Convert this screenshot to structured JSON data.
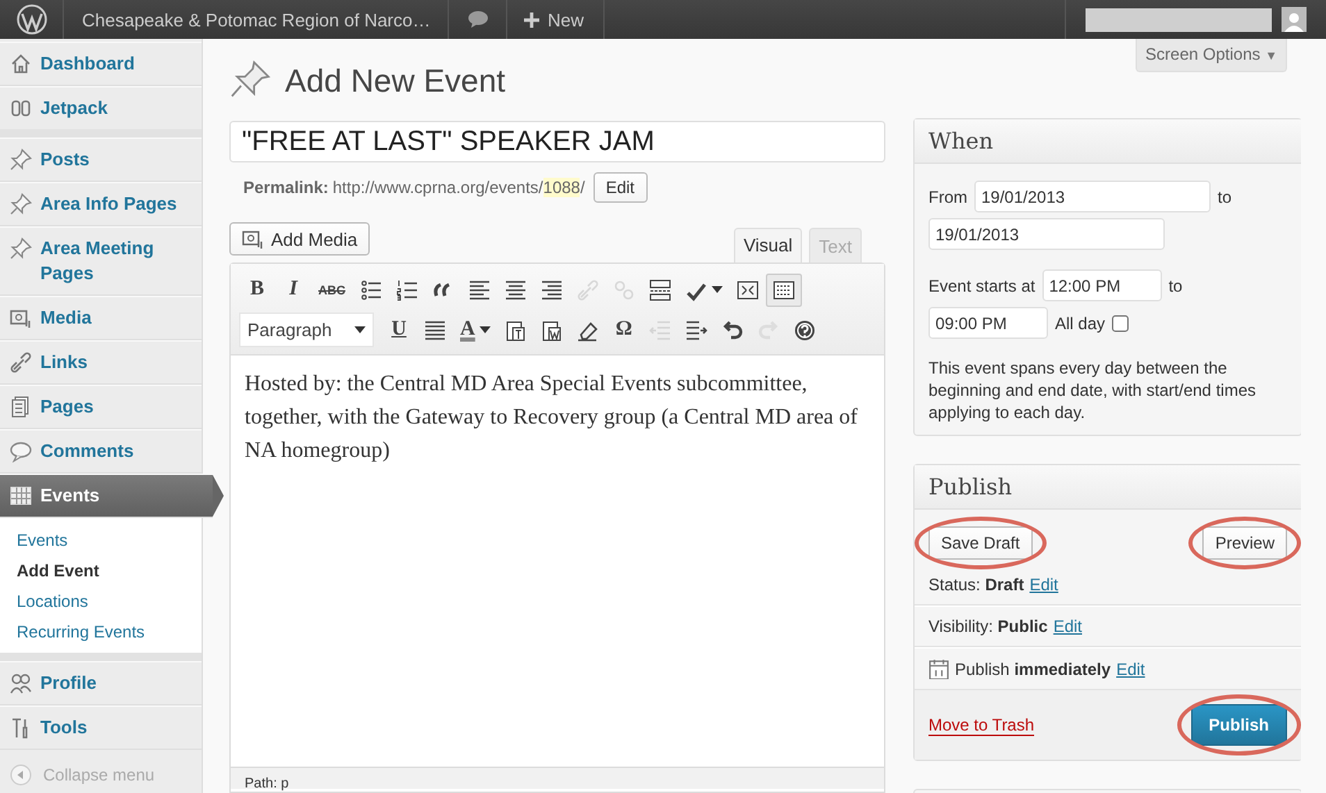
{
  "admin_bar": {
    "site_name": "Chesapeake & Potomac Region of Narco…",
    "new_label": "New"
  },
  "sidebar": {
    "items": [
      {
        "kind": "home",
        "label": "Dashboard",
        "selected": false,
        "separator_after": false
      },
      {
        "kind": "jetpack",
        "label": "Jetpack",
        "selected": false,
        "separator_after": true
      },
      {
        "kind": "pin",
        "label": "Posts",
        "selected": false,
        "separator_after": false
      },
      {
        "kind": "pin",
        "label": "Area Info Pages",
        "selected": false,
        "separator_after": false
      },
      {
        "kind": "pin",
        "label": "Area Meeting Pages",
        "selected": false,
        "separator_after": false
      },
      {
        "kind": "media",
        "label": "Media",
        "selected": false,
        "separator_after": false
      },
      {
        "kind": "link",
        "label": "Links",
        "selected": false,
        "separator_after": false
      },
      {
        "kind": "pages",
        "label": "Pages",
        "selected": false,
        "separator_after": false
      },
      {
        "kind": "comment",
        "label": "Comments",
        "selected": false,
        "separator_after": false
      },
      {
        "kind": "calendar",
        "label": "Events",
        "selected": true,
        "separator_after": true,
        "children": [
          {
            "label": "Events",
            "selected": false
          },
          {
            "label": "Add Event",
            "selected": true
          },
          {
            "label": "Locations",
            "selected": false
          },
          {
            "label": "Recurring Events",
            "selected": false
          }
        ]
      },
      {
        "kind": "users",
        "label": "Profile",
        "selected": false,
        "separator_after": false
      },
      {
        "kind": "tools",
        "label": "Tools",
        "selected": false,
        "separator_after": false
      }
    ],
    "collapse_label": "Collapse menu"
  },
  "screen_options": {
    "label": "Screen Options",
    "caret": "▼"
  },
  "heading": "Add New Event",
  "title_field": {
    "value": "\"FREE AT LAST\" SPEAKER JAM"
  },
  "permalink": {
    "label": "Permalink:",
    "url": "http://www.cprna.org/events/",
    "slug": "1088",
    "trail": "/",
    "button": "Edit"
  },
  "add_media": "Add Media",
  "editor_tabs": [
    {
      "label": "Visual",
      "selected": true
    },
    {
      "label": "Text",
      "selected": false
    }
  ],
  "toolbar_rows": [
    [
      {
        "kind": "bold",
        "glyph": "B",
        "disabled": false,
        "on": false
      },
      {
        "kind": "italic",
        "glyph": "I",
        "disabled": false,
        "on": false
      },
      {
        "kind": "strike",
        "glyph": "ABC",
        "disabled": false,
        "on": false
      },
      {
        "kind": "bullets",
        "disabled": false,
        "on": false
      },
      {
        "kind": "numbers",
        "disabled": false,
        "on": false
      },
      {
        "kind": "quote",
        "disabled": false,
        "on": false
      },
      {
        "kind": "align-left",
        "disabled": false,
        "on": false
      },
      {
        "kind": "align-center",
        "disabled": false,
        "on": false
      },
      {
        "kind": "align-right",
        "disabled": false,
        "on": false
      },
      {
        "kind": "link",
        "disabled": true,
        "on": false
      },
      {
        "kind": "unlink",
        "disabled": true,
        "on": false
      },
      {
        "kind": "more",
        "disabled": false,
        "on": false
      },
      {
        "kind": "spell",
        "disabled": false,
        "on": false
      },
      {
        "kind": "fullscreen",
        "disabled": false,
        "on": false
      },
      {
        "kind": "kitchen",
        "disabled": false,
        "on": true
      }
    ],
    [
      {
        "kind": "format",
        "glyph": "Paragraph",
        "disabled": false,
        "on": false
      },
      {
        "kind": "underline",
        "glyph": "U",
        "disabled": false,
        "on": false
      },
      {
        "kind": "justify",
        "disabled": false,
        "on": false
      },
      {
        "kind": "color",
        "glyph": "A",
        "disabled": false,
        "on": false
      },
      {
        "kind": "paste-text",
        "disabled": false,
        "on": false
      },
      {
        "kind": "paste-word",
        "disabled": false,
        "on": false
      },
      {
        "kind": "eraser",
        "disabled": false,
        "on": false
      },
      {
        "kind": "omega",
        "glyph": "Ω",
        "disabled": false,
        "on": false
      },
      {
        "kind": "outdent",
        "disabled": true,
        "on": false
      },
      {
        "kind": "indent",
        "disabled": false,
        "on": false
      },
      {
        "kind": "undo",
        "disabled": false,
        "on": false
      },
      {
        "kind": "redo",
        "disabled": true,
        "on": false
      },
      {
        "kind": "help",
        "disabled": false,
        "on": false
      }
    ]
  ],
  "editor_text": "Hosted by: the Central MD Area Special Events subcommittee, together, with the Gateway to Recovery group (a Central MD area of NA homegroup)",
  "path": "Path: p",
  "when": {
    "title": "When",
    "from_label": "From",
    "from_date": "19/01/2013",
    "to_label": "to",
    "to_date": "19/01/2013",
    "starts_label": "Event starts at",
    "start_time": "12:00 PM",
    "to_label_2": "to",
    "end_time": "09:00 PM",
    "all_day_label": "All day",
    "all_day_checked": false,
    "note": "This event spans every day between the beginning and end date, with start/end times applying to each day."
  },
  "publish": {
    "title": "Publish",
    "save_draft": {
      "label": "Save Draft",
      "circled": true
    },
    "preview": {
      "label": "Preview",
      "circled": true
    },
    "rows": [
      {
        "kind": "status",
        "text": "Status: **Draft**",
        "link": "Edit"
      },
      {
        "kind": "visibility",
        "text": "Visibility: **Public**",
        "link": "Edit"
      },
      {
        "kind": "schedule",
        "text": "Publish **immediately**",
        "link": "Edit"
      }
    ],
    "trash": "Move to Trash",
    "publish_button": {
      "label": "Publish",
      "circled": true
    }
  }
}
